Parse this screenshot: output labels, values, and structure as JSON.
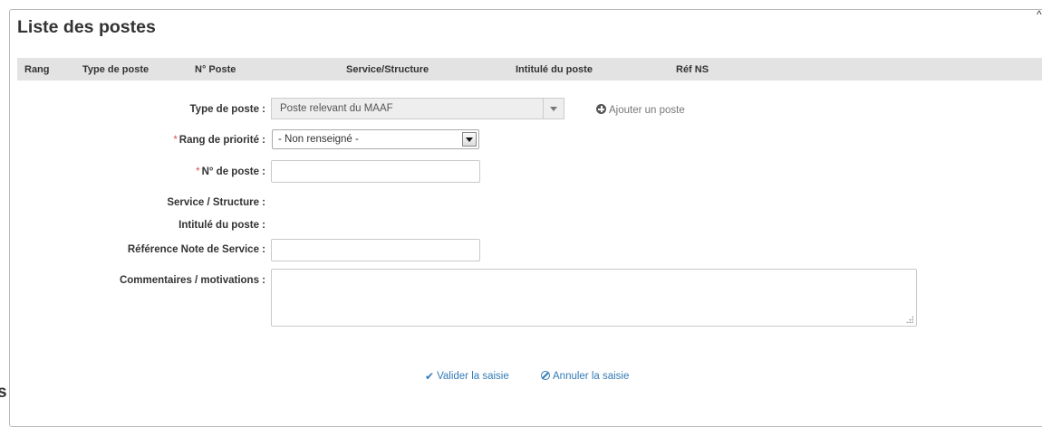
{
  "panel": {
    "title": "Liste des postes",
    "collapse_glyph": "^"
  },
  "table": {
    "columns": [
      "Rang",
      "Type de poste",
      "N° Poste",
      "Service/Structure",
      "Intitulé du poste",
      "Réf NS"
    ]
  },
  "form": {
    "type_poste": {
      "label": "Type de poste :",
      "value": "Poste relevant du MAAF"
    },
    "add_post": {
      "label": "Ajouter un poste",
      "icon": "plus-circle-icon"
    },
    "rang": {
      "required_mark": "*",
      "label": "Rang de priorité :",
      "value": "- Non renseigné -"
    },
    "num_poste": {
      "required_mark": "*",
      "label": "N° de poste :",
      "value": ""
    },
    "service": {
      "label": "Service / Structure :"
    },
    "intitule": {
      "label": "Intitulé du poste :"
    },
    "ref_ns": {
      "label": "Référence Note de Service :",
      "value": ""
    },
    "commentaires": {
      "label": "Commentaires / motivations :",
      "value": ""
    }
  },
  "actions": {
    "validate": {
      "label": "Valider la saisie",
      "icon": "check-icon"
    },
    "cancel": {
      "label": "Annuler la saisie",
      "icon": "ban-icon"
    }
  },
  "stray_text": "s",
  "colors": {
    "header_bg": "#e3e3e3",
    "link": "#337ab7",
    "required": "#d9534f"
  }
}
